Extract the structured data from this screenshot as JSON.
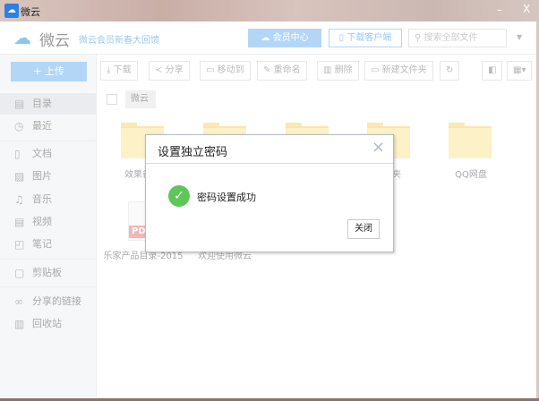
{
  "window": {
    "title": "微云",
    "minimize": "–",
    "close": "X"
  },
  "header": {
    "logo": "微云",
    "promo": "微云会员新春大回馈",
    "vip_button": "会员中心",
    "download_client": "下载客户端",
    "search_placeholder": "搜索全部文件"
  },
  "sidebar": {
    "upload": "上传",
    "items": [
      {
        "label": "目录",
        "icon": "catalog-icon"
      },
      {
        "label": "最近",
        "icon": "clock-icon"
      },
      {
        "label": "文档",
        "icon": "document-icon"
      },
      {
        "label": "图片",
        "icon": "image-icon"
      },
      {
        "label": "音乐",
        "icon": "music-icon"
      },
      {
        "label": "视频",
        "icon": "video-icon"
      },
      {
        "label": "笔记",
        "icon": "note-icon"
      },
      {
        "label": "剪贴板",
        "icon": "clipboard-icon"
      },
      {
        "label": "分享的链接",
        "icon": "link-icon"
      },
      {
        "label": "回收站",
        "icon": "trash-icon"
      }
    ]
  },
  "toolbar": {
    "download": "下载",
    "share": "分享",
    "move": "移动到",
    "rename": "重命名",
    "delete": "删除",
    "new_folder": "新建文件夹"
  },
  "breadcrumb": {
    "root": "微云"
  },
  "files": {
    "f1": "效果备份",
    "f4": "收藏夹",
    "f5": "QQ网盘",
    "pdf_tag": "PDF",
    "pdf_name": "乐家产品目录-2015",
    "welcome": "欢迎使用微云"
  },
  "dialog": {
    "title": "设置独立密码",
    "message": "密码设置成功",
    "close_button": "关闭",
    "close_icon": "×"
  },
  "colors": {
    "accent": "#b3d6f7",
    "success": "#5fc65a",
    "folder": "#fdf1c8"
  }
}
